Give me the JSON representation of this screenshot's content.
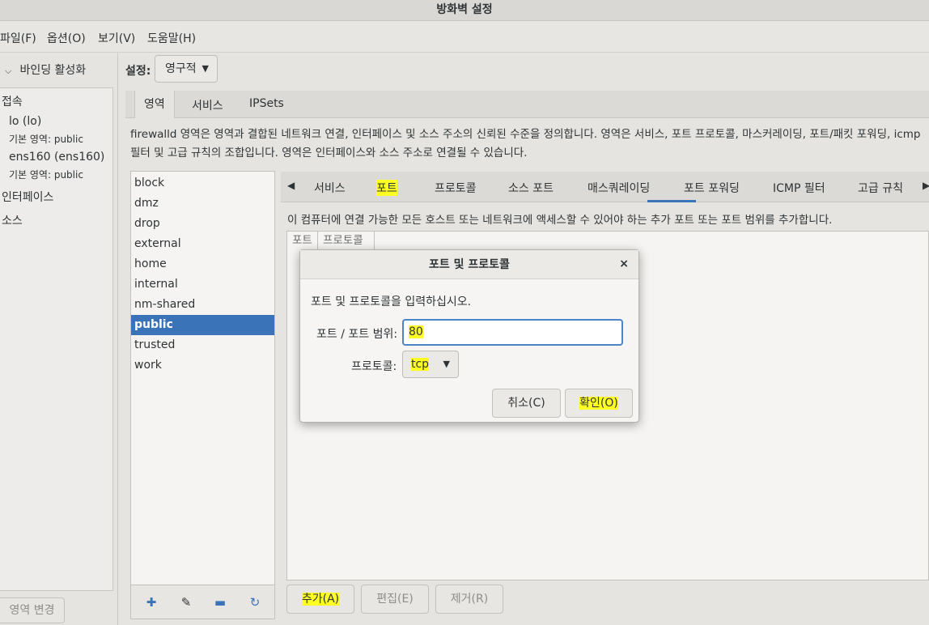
{
  "window": {
    "title": "방화벽 설정"
  },
  "menu": [
    "파일(F)",
    "옵션(O)",
    "보기(V)",
    "도움말(H)"
  ],
  "left": {
    "binding_toggle": "바인딩 활성화",
    "connections_header": "접속",
    "connections": [
      {
        "name": "lo (lo)",
        "zone": "기본 영역: public"
      },
      {
        "name": "ens160 (ens160)",
        "zone": "기본 영역: public"
      }
    ],
    "interfaces_header": "인터페이스",
    "sources_header": "소스",
    "change_zone_button": "영역 변경"
  },
  "settings": {
    "label": "설정:",
    "value": "영구적"
  },
  "outer_tabs": [
    "영역",
    "서비스",
    "IPSets"
  ],
  "zone_description": "firewalld 영역은 영역과 결합된 네트워크 연결, 인터페이스 및 소스 주소의 신뢰된 수준을 정의합니다. 영역은 서비스, 포트 프로토콜, 마스커레이딩, 포트/패킷 포워딩, icmp 필터 및 고급 규칙의 조합입니다. 영역은 인터페이스와 소스 주소로 연결될 수 있습니다.",
  "zones": [
    "block",
    "dmz",
    "drop",
    "external",
    "home",
    "internal",
    "nm-shared",
    "public",
    "trusted",
    "work"
  ],
  "selected_zone": "public",
  "inner_tabs": [
    "서비스",
    "포트",
    "프로토콜",
    "소스 포트",
    "매스쿼레이딩",
    "포트 포워딩",
    "ICMP 필터",
    "고급 규칙"
  ],
  "active_inner_tab": "포트",
  "port_description": "이 컴퓨터에 연결 가능한 모든 호스트 또는 네트워크에 액세스할 수 있어야 하는 추가 포트 또는 포트 범위를 추가합니다.",
  "port_table": {
    "columns": [
      "포트",
      "프로토콜"
    ]
  },
  "bottom_buttons": {
    "add": "추가(A)",
    "edit": "편집(E)",
    "remove": "제거(R)"
  },
  "dialog": {
    "title": "포트 및 프로토콜",
    "close": "×",
    "prompt": "포트 및 프로토콜을 입력하십시오.",
    "port_label": "포트 / 포트 범위:",
    "port_value": "80",
    "protocol_label": "프로토콜:",
    "protocol_value": "tcp",
    "cancel": "취소(C)",
    "ok": "확인(O)"
  },
  "colors": {
    "selection": "#3b73b9",
    "highlight": "#ffff22",
    "focus_border": "#4a85c8"
  },
  "icons": {
    "add_zone": "plus-icon",
    "edit_zone": "edit-icon",
    "remove_zone": "minus-icon",
    "reload_zone": "reload-icon"
  }
}
